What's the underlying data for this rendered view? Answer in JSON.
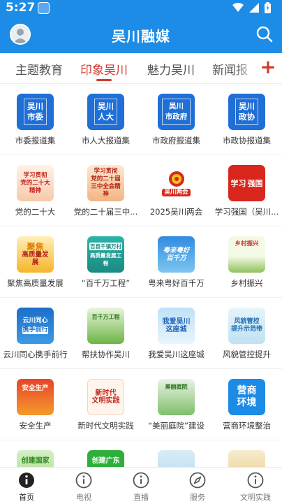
{
  "status_bar": {
    "time": "5:27"
  },
  "header": {
    "title": "吴川融媒",
    "avatar_icon": "user-avatar",
    "search_icon": "search-icon"
  },
  "tabs": [
    {
      "label": "主题教育",
      "active": false
    },
    {
      "label": "印象吴川",
      "active": true
    },
    {
      "label": "魅力吴川",
      "active": false
    },
    {
      "label": "新闻报",
      "active": false
    }
  ],
  "add_channel_label": "+",
  "grid": {
    "rows": [
      [
        {
          "label": "市委报道集",
          "tile_text": [
            "吴川",
            "市委"
          ],
          "tile_style": "blue"
        },
        {
          "label": "市人大报道集",
          "tile_text": [
            "吴川",
            "人大"
          ],
          "tile_style": "blue"
        },
        {
          "label": "市政府报道集",
          "tile_text": [
            "吴川",
            "市政府"
          ],
          "tile_style": "blue"
        },
        {
          "label": "市政协报道集",
          "tile_text": [
            "吴川",
            "政协"
          ],
          "tile_style": "blue"
        }
      ],
      [
        {
          "label": "党的二十大",
          "tile_text": [
            "学习贯彻",
            "党的二十大精神"
          ],
          "tile_style": "red-light"
        },
        {
          "label": "党的二十届三中...",
          "tile_text": [
            "学习贯彻",
            "党的二十届",
            "三中全会精神"
          ],
          "tile_style": "red-light"
        },
        {
          "label": "2025吴川两会",
          "tile_text": [
            "吴川两会"
          ],
          "tile_style": "emblem"
        },
        {
          "label": "学习强国（吴川...",
          "tile_text": [
            "学习",
            "强国"
          ],
          "tile_style": "xuexi"
        }
      ],
      [
        {
          "label": "聚焦高质量发展",
          "tile_text": [
            "聚焦",
            "高质量发展"
          ],
          "tile_style": "gold"
        },
        {
          "label": "“百千万工程”",
          "tile_text": [
            "百县千镇万村",
            "高质量发展工程"
          ],
          "tile_style": "teal"
        },
        {
          "label": "粤来粤好百千万",
          "tile_text": [
            "粤来粤好",
            "百千万"
          ],
          "tile_style": "green-blue"
        },
        {
          "label": "乡村振兴",
          "tile_text": [
            "乡村振兴"
          ],
          "tile_style": "rural"
        }
      ],
      [
        {
          "label": "云川同心携手前行",
          "tile_text": [
            "云川同心",
            "携手前行"
          ],
          "tile_style": "blue-dark"
        },
        {
          "label": "帮扶协作吴川",
          "tile_text": [
            "百千万工程"
          ],
          "tile_style": "green-leaf"
        },
        {
          "label": "我爱吴川这座城",
          "tile_text": [
            "我爱吴川",
            "这座城"
          ],
          "tile_style": "sky"
        },
        {
          "label": "风貌管控提升",
          "tile_text": [
            "风貌管控",
            "提升示范带"
          ],
          "tile_style": "pale-blue"
        }
      ],
      [
        {
          "label": "安全生产",
          "tile_text": [
            "安全生产"
          ],
          "tile_style": "orange"
        },
        {
          "label": "新时代文明实践",
          "tile_text": [
            "新时代",
            "文明实践"
          ],
          "tile_style": "red-white"
        },
        {
          "label": "“美丽庭院”建设",
          "tile_text": [
            "美丽庭院"
          ],
          "tile_style": "garden"
        },
        {
          "label": "营商环境整治",
          "tile_text": [
            "营商",
            "环境"
          ],
          "tile_style": "blue-plain"
        }
      ],
      [
        {
          "label": "",
          "tile_text": [
            "创建国家"
          ],
          "tile_style": "green-soft"
        },
        {
          "label": "",
          "tile_text": [
            "创建广东"
          ],
          "tile_style": "green-solid"
        },
        {
          "label": "",
          "tile_text": [],
          "tile_style": "pale-sky"
        },
        {
          "label": "",
          "tile_text": [],
          "tile_style": "pale-gold"
        }
      ]
    ]
  },
  "bottom_nav": [
    {
      "label": "首页",
      "icon": "info-circle-icon",
      "active": true
    },
    {
      "label": "电视",
      "icon": "info-circle-icon",
      "active": false
    },
    {
      "label": "直播",
      "icon": "info-circle-icon",
      "active": false
    },
    {
      "label": "服务",
      "icon": "compass-icon",
      "active": false
    },
    {
      "label": "文明实践",
      "icon": "info-circle-icon",
      "active": false
    }
  ]
}
